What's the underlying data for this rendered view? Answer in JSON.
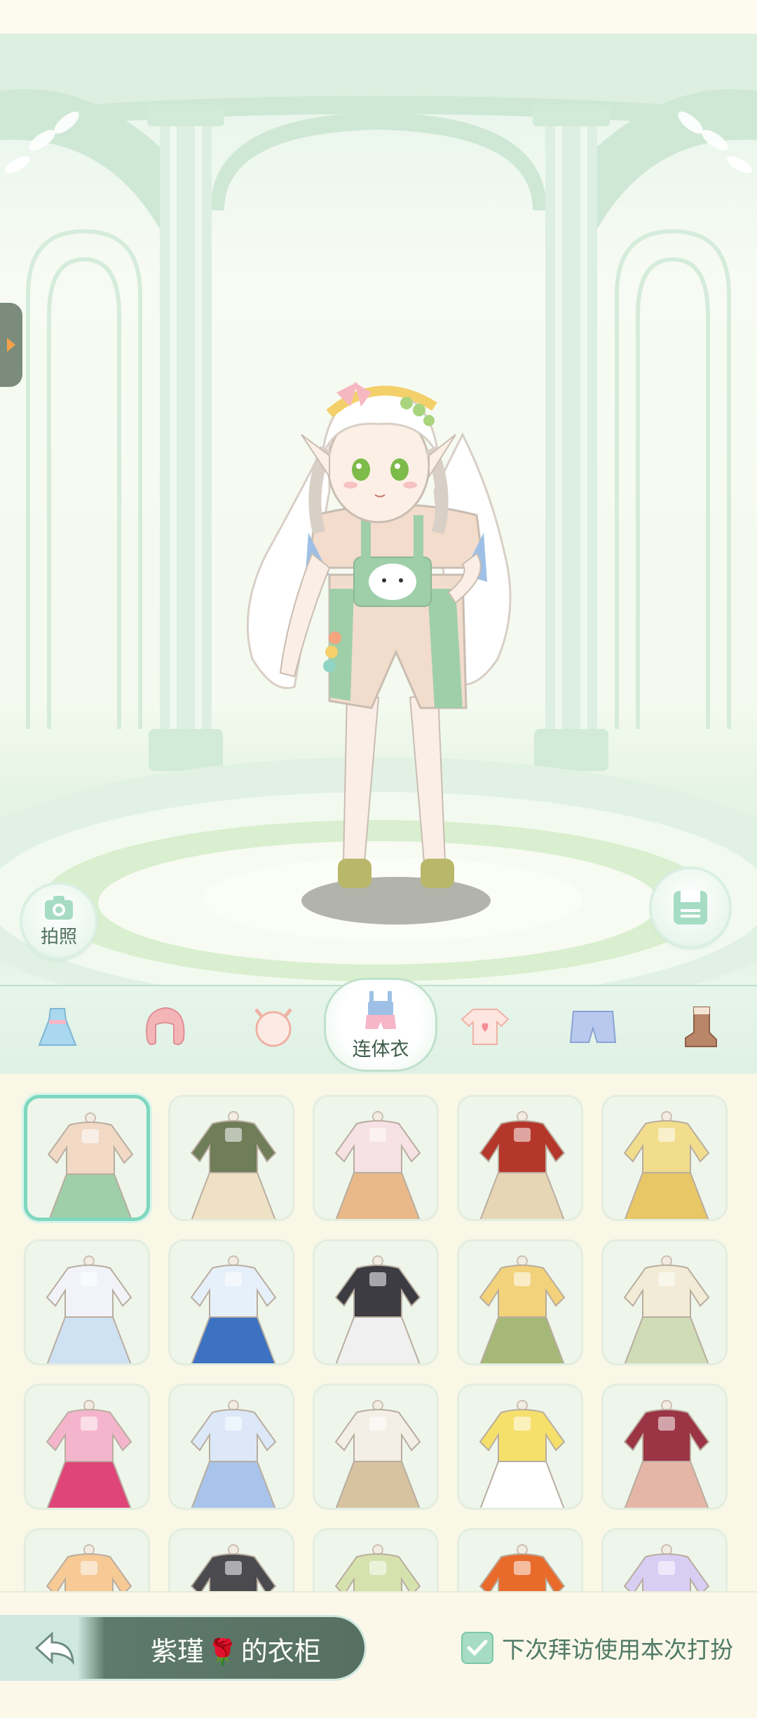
{
  "stage": {
    "photo_label": "拍照",
    "side_tab_icon": "arrow-right-icon",
    "save_icon": "save-icon"
  },
  "tabs": [
    {
      "name": "dress",
      "icon": "dress-icon",
      "label": ""
    },
    {
      "name": "hair",
      "icon": "hair-icon",
      "label": ""
    },
    {
      "name": "face",
      "icon": "face-icon",
      "label": ""
    },
    {
      "name": "jumpsuit",
      "icon": "overalls-icon",
      "label": "连体衣",
      "active": true
    },
    {
      "name": "top",
      "icon": "tshirt-icon",
      "label": ""
    },
    {
      "name": "bottom",
      "icon": "shorts-icon",
      "label": ""
    },
    {
      "name": "shoes",
      "icon": "boot-icon",
      "label": ""
    }
  ],
  "outfits": [
    {
      "row": 1,
      "col": 1,
      "selected": true,
      "colors": [
        "#f1d9c6",
        "#9fcfa9"
      ]
    },
    {
      "row": 1,
      "col": 2,
      "colors": [
        "#6f7d59",
        "#efe1c4"
      ]
    },
    {
      "row": 1,
      "col": 3,
      "colors": [
        "#f6e1e4",
        "#e9b98a"
      ]
    },
    {
      "row": 1,
      "col": 4,
      "colors": [
        "#b5372b",
        "#e7d6b6"
      ]
    },
    {
      "row": 1,
      "col": 5,
      "colors": [
        "#f1dd8c",
        "#e7c766"
      ]
    },
    {
      "row": 2,
      "col": 1,
      "colors": [
        "#f1f3f8",
        "#cfe2f3"
      ]
    },
    {
      "row": 2,
      "col": 2,
      "colors": [
        "#e6f0fb",
        "#3d72c2"
      ]
    },
    {
      "row": 2,
      "col": 3,
      "colors": [
        "#3c3c42",
        "#f0f0f0"
      ]
    },
    {
      "row": 2,
      "col": 4,
      "colors": [
        "#f2d27a",
        "#a6b877"
      ]
    },
    {
      "row": 2,
      "col": 5,
      "colors": [
        "#f2ecd6",
        "#cfdcb5"
      ]
    },
    {
      "row": 3,
      "col": 1,
      "colors": [
        "#f4b5cc",
        "#e0457a"
      ]
    },
    {
      "row": 3,
      "col": 2,
      "colors": [
        "#dce8f8",
        "#a9c4ea"
      ]
    },
    {
      "row": 3,
      "col": 3,
      "colors": [
        "#f4efe6",
        "#d7c3a0"
      ]
    },
    {
      "row": 3,
      "col": 4,
      "colors": [
        "#f5e06c",
        "#ffffff"
      ]
    },
    {
      "row": 3,
      "col": 5,
      "colors": [
        "#9b3444",
        "#e5b6a7"
      ]
    },
    {
      "row": 4,
      "col": 1,
      "colors": [
        "#f6c995",
        "#f2b27a"
      ]
    },
    {
      "row": 4,
      "col": 2,
      "colors": [
        "#4b4b4f",
        "#8b8b90"
      ]
    },
    {
      "row": 4,
      "col": 3,
      "colors": [
        "#d6e2ad",
        "#eef2d2"
      ]
    },
    {
      "row": 4,
      "col": 4,
      "colors": [
        "#e86b2c",
        "#2e2e33"
      ]
    },
    {
      "row": 4,
      "col": 5,
      "colors": [
        "#d8cdf3",
        "#9f8fd9"
      ]
    }
  ],
  "footer": {
    "back_icon": "back-arrow-icon",
    "owner_name": "紫瑾",
    "rose_icon": "🌹",
    "wardrobe_suffix": "的衣柜",
    "remember_label": "下次拜访使用本次打扮",
    "remember_checked": true
  },
  "colors": {
    "accent": "#7ed8bf",
    "pill": "#567061",
    "background": "#fbf8ea"
  }
}
